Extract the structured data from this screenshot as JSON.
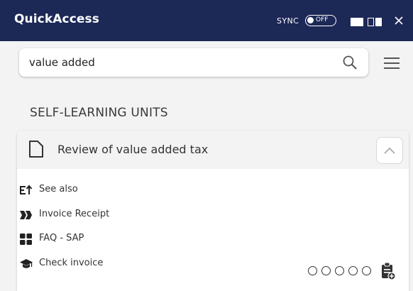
{
  "titlebar": {
    "title": "QuickAccess",
    "sync_label": "SYNC",
    "sync_state": "OFF"
  },
  "search": {
    "value": "value added",
    "placeholder": ""
  },
  "section": {
    "heading": "SELF-LEARNING UNITS"
  },
  "card": {
    "title": "Review of value added tax",
    "items": [
      {
        "label": "See also",
        "icon": "see-also-icon"
      },
      {
        "label": "Invoice Receipt",
        "icon": "process-chevrons-icon"
      },
      {
        "label": "FAQ - SAP",
        "icon": "grid-icon"
      },
      {
        "label": "Check invoice",
        "icon": "graduation-cap-icon"
      }
    ],
    "rating": {
      "value": 0,
      "max": 5
    }
  },
  "colors": {
    "titlebar_bg": "#1c2856",
    "panel_bg": "#f3f3f3",
    "card_bg": "#ffffff"
  }
}
